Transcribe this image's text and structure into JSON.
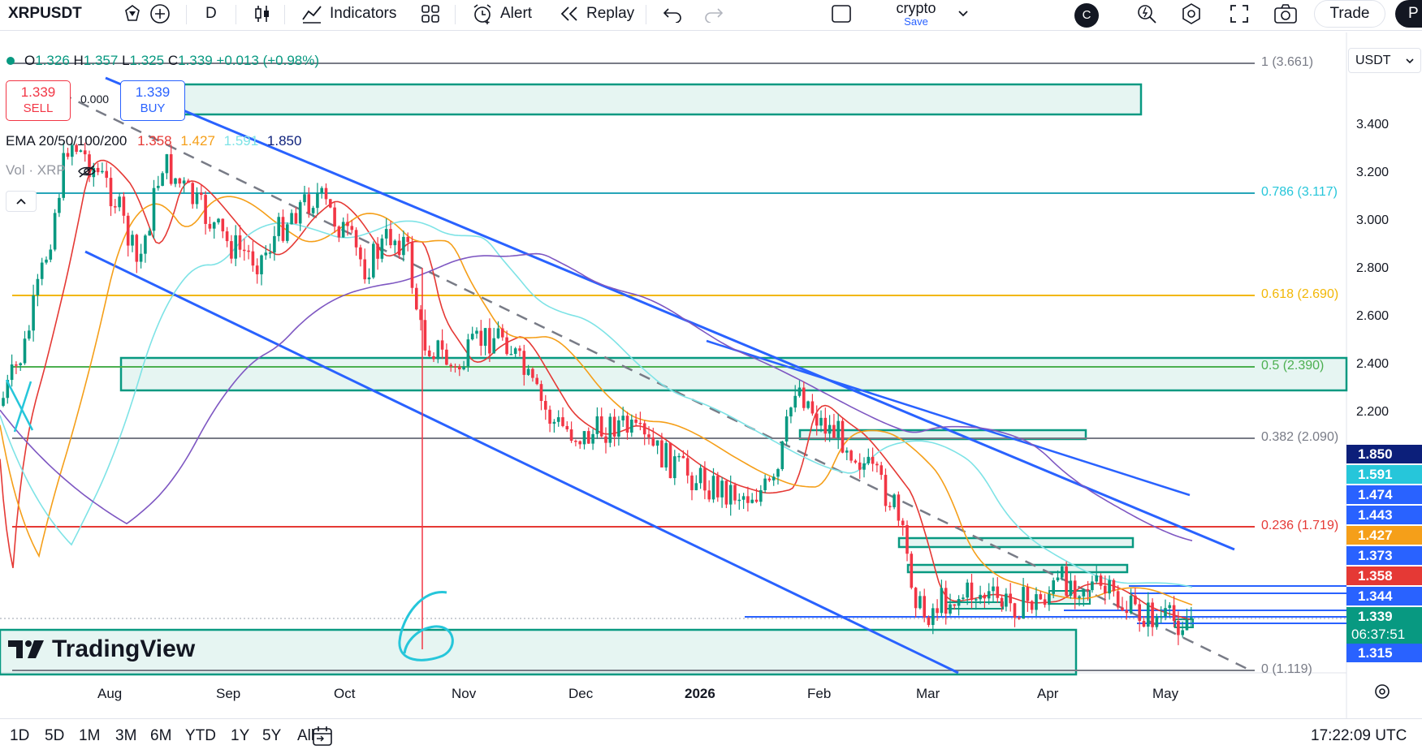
{
  "toolbar": {
    "symbol": "XRPUSDT",
    "interval": "D",
    "indicators_label": "Indicators",
    "alert_label": "Alert",
    "replay_label": "Replay",
    "layout_name": "crypto",
    "layout_save": "Save",
    "avatar_letter": "C",
    "trade_label": "Trade",
    "publish_label": "P"
  },
  "legend": {
    "o_label": "O",
    "o_value": "1.326",
    "h_label": "H",
    "h_value": "1.357",
    "l_label": "L",
    "l_value": "1.325",
    "c_label": "C",
    "c_value": "1.339",
    "change": "+0.013 (+0.98%)",
    "ema_label": "EMA 20/50/100/200",
    "ema20": "1.358",
    "ema50": "1.427",
    "ema100": "1.591",
    "ema200": "1.850",
    "vol_label": "Vol · XRP"
  },
  "trade": {
    "sell_price": "1.339",
    "sell_label": "SELL",
    "spread": "0.000",
    "buy_price": "1.339",
    "buy_label": "BUY"
  },
  "currency": "USDT",
  "fib_levels": [
    {
      "label": "1 (3.661)",
      "color": "#787b86"
    },
    {
      "label": "0.786 (3.117)",
      "color": "#26c6da"
    },
    {
      "label": "0.618 (2.690)",
      "color": "#f2b705"
    },
    {
      "label": "0.5 (2.390)",
      "color": "#4caf50"
    },
    {
      "label": "0.382 (2.090)",
      "color": "#787b86"
    },
    {
      "label": "0.236 (1.719)",
      "color": "#e53935"
    },
    {
      "label": "0 (1.119)",
      "color": "#787b86"
    }
  ],
  "y_axis": [
    "3.400",
    "3.200",
    "3.000",
    "2.800",
    "2.600",
    "2.400",
    "2.200"
  ],
  "price_badges": [
    {
      "value": "1.850",
      "color": "#0c1f7a"
    },
    {
      "value": "1.591",
      "color": "#26c6da"
    },
    {
      "value": "1.474",
      "color": "#2962ff"
    },
    {
      "value": "1.443",
      "color": "#2962ff"
    },
    {
      "value": "1.427",
      "color": "#f59f19"
    },
    {
      "value": "1.373",
      "color": "#2962ff"
    },
    {
      "value": "1.358",
      "color": "#e53935"
    },
    {
      "value": "1.344",
      "color": "#2962ff"
    },
    {
      "value": "1.339",
      "color": "#089981"
    },
    {
      "value": "06:37:51",
      "color": "#089981"
    },
    {
      "value": "1.315",
      "color": "#2962ff"
    }
  ],
  "x_axis": [
    "Aug",
    "Sep",
    "Oct",
    "Nov",
    "Dec",
    "2026",
    "Feb",
    "Mar",
    "Apr",
    "May"
  ],
  "annotation_text": "6",
  "watermark": "TradingView",
  "bottom": {
    "ranges": [
      "1D",
      "5D",
      "1M",
      "3M",
      "6M",
      "YTD",
      "1Y",
      "5Y",
      "All"
    ],
    "clock": "17:22:09 UTC"
  },
  "colors": {
    "up": "#089981",
    "down": "#f23645",
    "ema20": "#e53935",
    "ema50": "#f59f19",
    "ema100": "#7ee3e6",
    "ema200": "#7e57c2",
    "channel": "#2962ff",
    "zone": "#089981"
  }
}
